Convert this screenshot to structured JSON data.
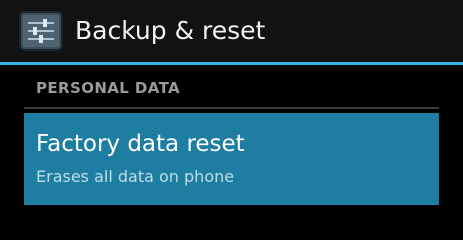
{
  "action_bar": {
    "icon": "settings-sliders-icon",
    "title": "Backup & reset",
    "accent_color": "#33b5e5"
  },
  "section": {
    "header": "PERSONAL DATA"
  },
  "items": [
    {
      "title": "Factory data reset",
      "summary": "Erases all data on phone",
      "highlight_color": "#1d7ea1"
    }
  ]
}
